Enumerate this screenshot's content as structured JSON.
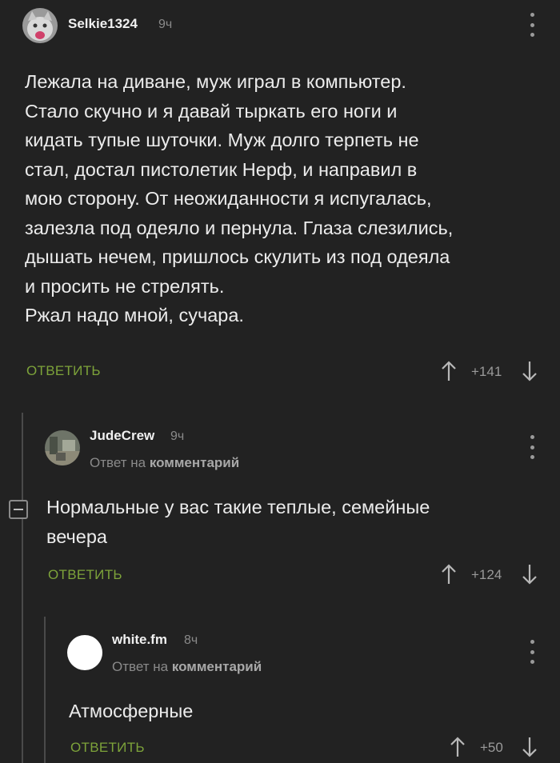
{
  "comments": [
    {
      "username": "Selkie1324",
      "time": "9ч",
      "text": "Лежала на диване, муж играл в компьютер.\nСтало скучно и я давай тыркать его ноги и\nкидать тупые шуточки. Муж долго терпеть не\nстал, достал пистолетик Нерф, и направил в\nмою сторону. От неожиданности я испугалась,\nзалезла под одеяло и пернула. Глаза слезились,\nдышать нечем, пришлось скулить из под одеяла\nи просить не стрелять.\nРжал надо мной, сучара.",
      "reply_label": "ОТВЕТИТЬ",
      "rating": "+141"
    },
    {
      "username": "JudeCrew",
      "time": "9ч",
      "reply_prefix": "Ответ на",
      "reply_target": "комментарий",
      "text": "Нормальные у вас такие теплые, семейные\nвечера",
      "reply_label": "ОТВЕТИТЬ",
      "rating": "+124"
    },
    {
      "username": "white.fm",
      "time": "8ч",
      "reply_prefix": "Ответ на",
      "reply_target": "комментарий",
      "text": "Атмосферные",
      "reply_label": "ОТВЕТИТЬ",
      "rating": "+50"
    }
  ],
  "icons": {
    "upvote": "arrow-up-icon",
    "downvote": "arrow-down-icon",
    "menu": "kebab-menu-icon",
    "collapse": "collapse-thread-icon"
  },
  "colors": {
    "background": "#222222",
    "accent": "#7da33a",
    "muted": "#8a8a8a"
  }
}
